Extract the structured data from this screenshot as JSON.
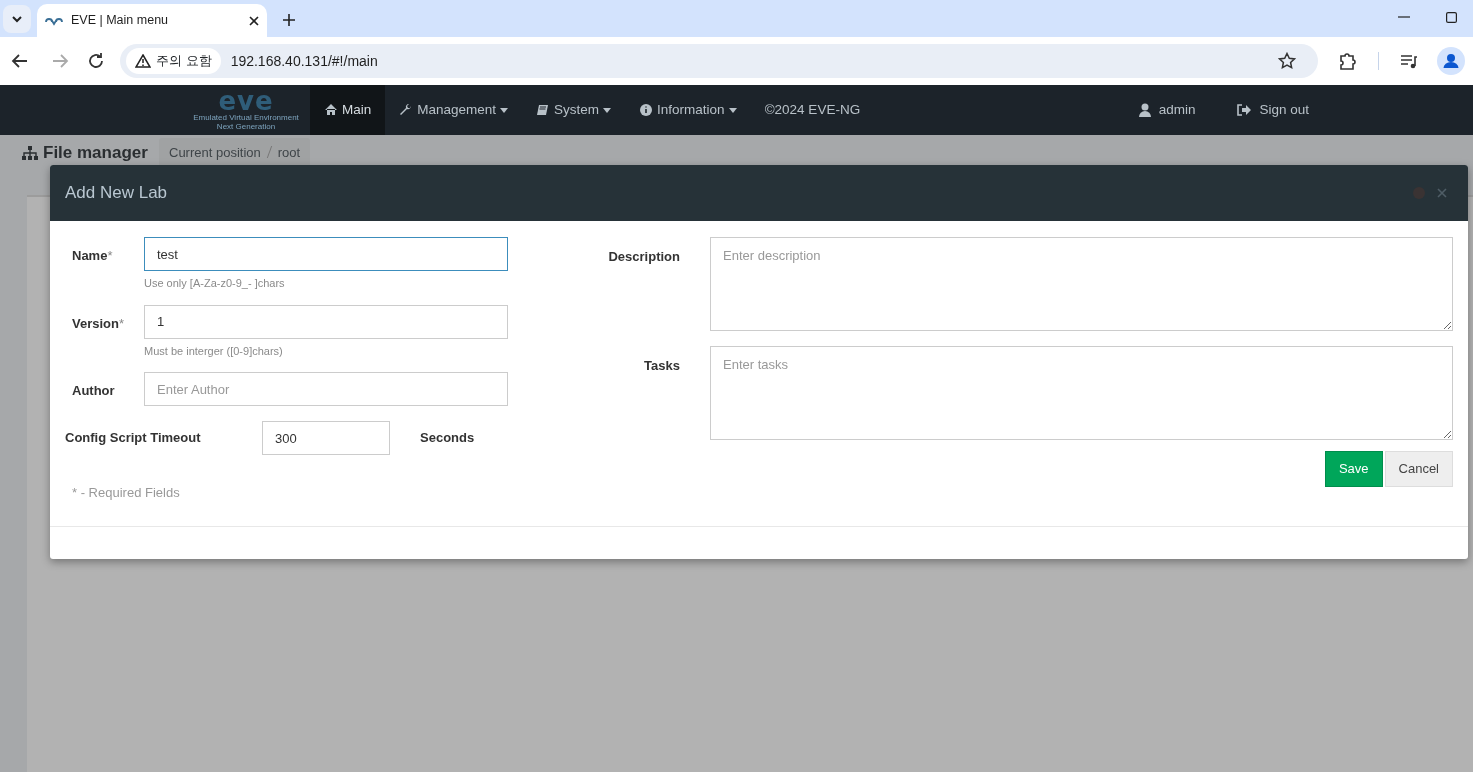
{
  "browser": {
    "tab_title": "EVE | Main menu",
    "security_label": "주의 요함",
    "url": "192.168.40.131/#!/main"
  },
  "navbar": {
    "logo": "eve",
    "logo_subtitle": "Emulated Virtual Environment",
    "logo_subtitle_2": "Next Generation",
    "items": [
      {
        "label": "Main",
        "dropdown": false,
        "selected": true
      },
      {
        "label": "Management",
        "dropdown": true,
        "selected": false
      },
      {
        "label": "System",
        "dropdown": true,
        "selected": false
      },
      {
        "label": "Information",
        "dropdown": true,
        "selected": false
      },
      {
        "label": "©2024 EVE-NG",
        "dropdown": false,
        "selected": false
      }
    ],
    "user": "admin",
    "sign_out": "Sign out"
  },
  "page": {
    "title": "File manager",
    "breadcrumb": [
      "Current position",
      "root"
    ]
  },
  "modal": {
    "title": "Add New Lab",
    "fields": [
      {
        "label": "Name",
        "mark": "*",
        "value": "test",
        "focused": true,
        "help": "Use only [A-Za-z0-9_- ]chars"
      },
      {
        "label": "Version",
        "mark": "*",
        "value": "1",
        "focused": false,
        "help": "Must be interger ([0-9]chars)"
      },
      {
        "label": "Author",
        "placeholder": "Enter Author",
        "focused": false
      }
    ],
    "timeout": {
      "label": "Config Script Timeout",
      "value": "300",
      "unit": "Seconds"
    },
    "required_note": "* - Required Fields",
    "text_areas": [
      {
        "label": "Description",
        "placeholder": "Enter description"
      },
      {
        "label": "Tasks",
        "placeholder": "Enter tasks"
      }
    ],
    "buttons": [
      {
        "label": "Save",
        "kind": "primary"
      },
      {
        "label": "Cancel",
        "kind": "secondary"
      }
    ]
  }
}
